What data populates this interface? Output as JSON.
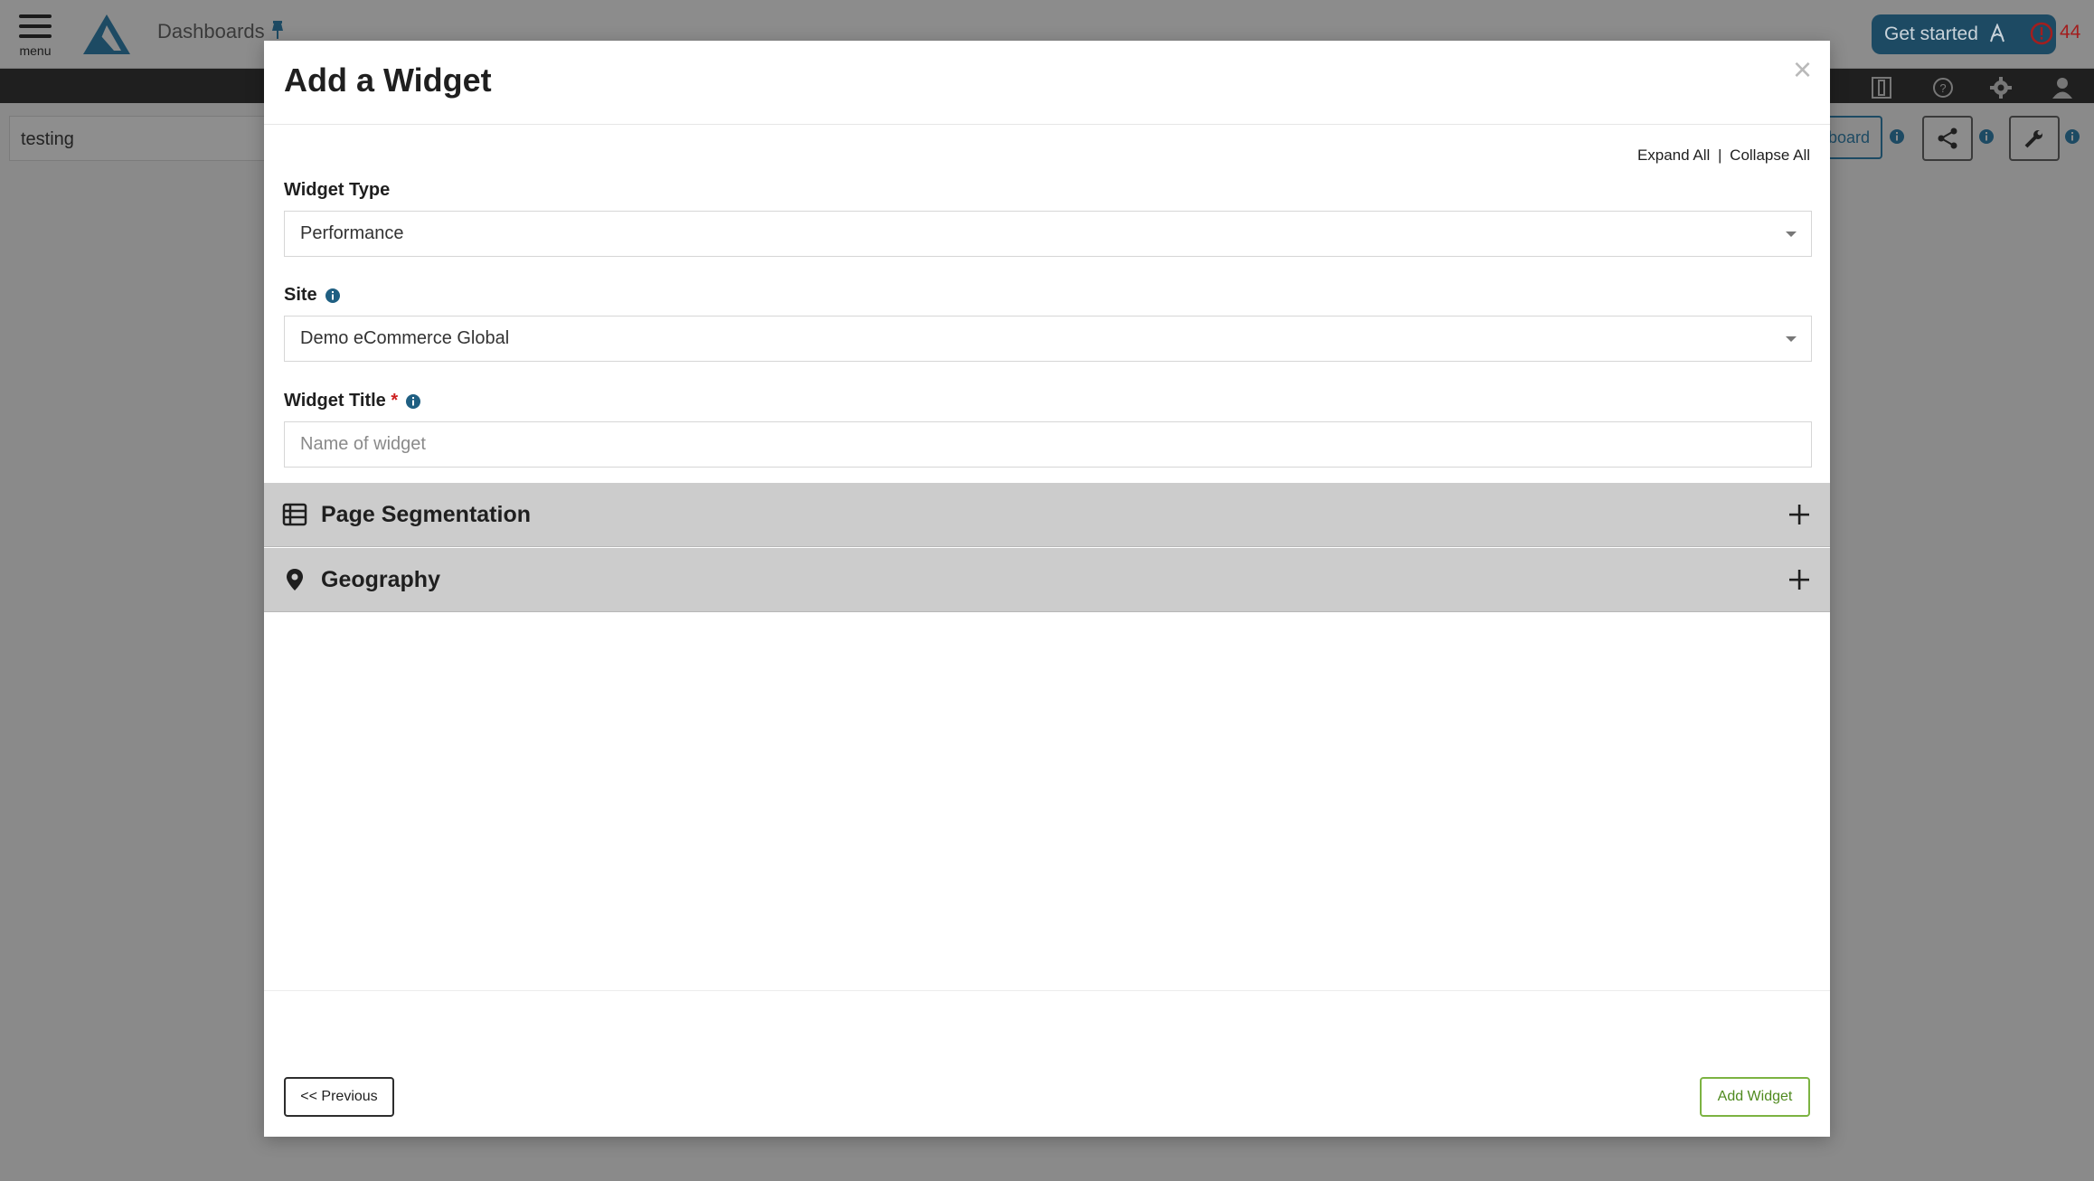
{
  "app": {
    "menu_label": "menu",
    "breadcrumb": "Dashboards",
    "get_started": "Get started",
    "alert_count": "44",
    "filter_value": "testing",
    "dashboard_btn_partial": "board"
  },
  "modal": {
    "title": "Add a Widget",
    "close": "×",
    "expand_all": "Expand All",
    "separator": "|",
    "collapse_all": "Collapse All",
    "widget_type": {
      "label": "Widget Type",
      "value": "Performance"
    },
    "site": {
      "label": "Site",
      "value": "Demo eCommerce Global"
    },
    "widget_title": {
      "label": "Widget Title",
      "required_mark": "*",
      "placeholder": "Name of widget",
      "value": ""
    },
    "sections": [
      {
        "label": "Page Segmentation",
        "icon": "table-list-icon"
      },
      {
        "label": "Geography",
        "icon": "map-marker-icon"
      }
    ],
    "previous_label": "<< Previous",
    "add_label": "Add Widget"
  },
  "colors": {
    "accent": "#1d4a63",
    "add_button": "#7cb342",
    "required": "#cc1f1f",
    "overlay": "#8a8a8a"
  }
}
